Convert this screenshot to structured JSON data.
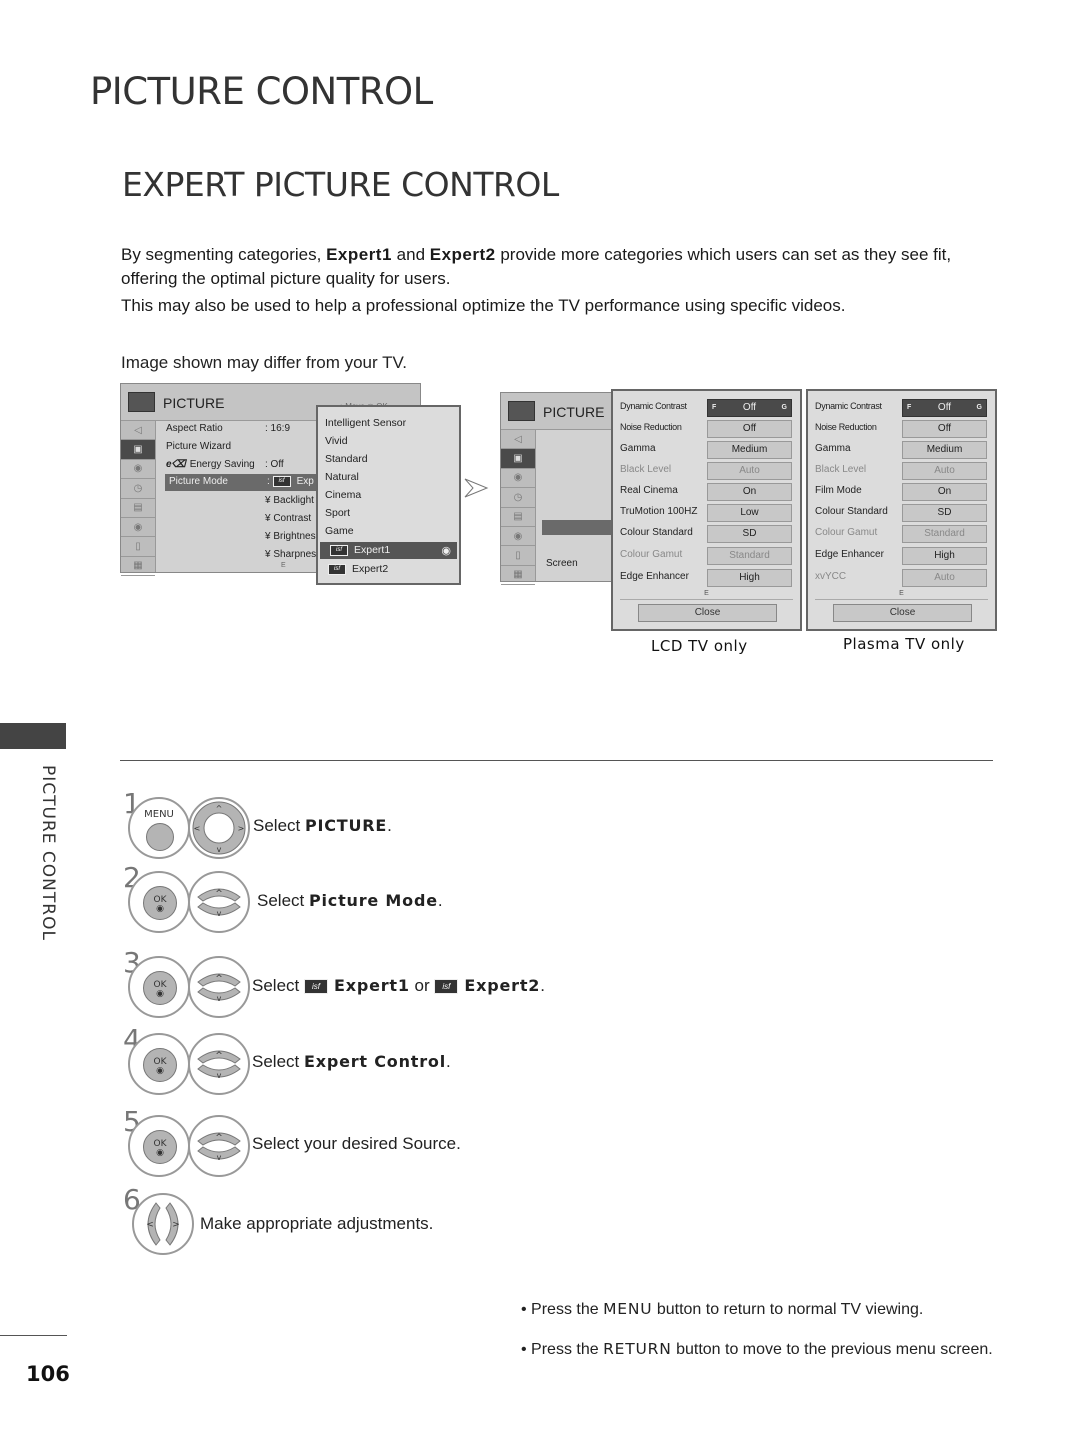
{
  "page": {
    "title": "PICTURE CONTROL",
    "subtitle": "EXPERT PICTURE CONTROL",
    "side_tab_label": "PICTURE CONTROL",
    "page_number": "106"
  },
  "intro": {
    "p1_before": "By segmenting categories, ",
    "expert1": "Expert1",
    "p1_and": " and ",
    "expert2": "Expert2",
    "p1_after": " provide more categories which users can set as they see fit, offering the optimal picture quality for users.",
    "p2": "This may also be used to help a professional optimize the TV performance using specific videos.",
    "note": "Image shown may differ from your TV."
  },
  "screen1": {
    "title": "PICTURE",
    "hint": "↕ Move   ◉ OK",
    "menu": [
      {
        "label": "Aspect Ratio",
        "value": ": 16:9"
      },
      {
        "label": "Picture Wizard",
        "value": ""
      },
      {
        "label": "Energy Saving",
        "value": ": Off",
        "icon": "eco-icon"
      },
      {
        "label": "Picture Mode",
        "value": ":",
        "selected_value": "Exp"
      }
    ],
    "sub_items": [
      "¥ Backlight",
      "¥ Contrast",
      "¥ Brightness",
      "¥ Sharpness"
    ],
    "scroll_hint": "E",
    "popup_items": [
      "Intelligent Sensor",
      "Vivid",
      "Standard",
      "Natural",
      "Cinema",
      "Sport",
      "Game",
      "Expert1",
      "Expert2"
    ],
    "popup_selected": "Expert1",
    "isf_badge": "isf"
  },
  "screen2": {
    "title": "PICTURE",
    "item": "Screen"
  },
  "panel_lcd": {
    "caption": "LCD TV only",
    "rows": [
      {
        "label": "Dynamic Contrast",
        "value": "Off",
        "state": "selected",
        "left": "F",
        "right": "G"
      },
      {
        "label": "Noise Reduction",
        "value": "Off",
        "state": "normal"
      },
      {
        "label": "Gamma",
        "value": "Medium",
        "state": "normal"
      },
      {
        "label": "Black Level",
        "value": "Auto",
        "state": "disabled"
      },
      {
        "label": "Real Cinema",
        "value": "On",
        "state": "normal"
      },
      {
        "label": "TruMotion 100HZ",
        "value": "Low",
        "state": "normal"
      },
      {
        "label": "Colour Standard",
        "value": "SD",
        "state": "normal"
      },
      {
        "label": "Colour Gamut",
        "value": "Standard",
        "state": "disabled"
      },
      {
        "label": "Edge Enhancer",
        "value": "High",
        "state": "normal"
      }
    ],
    "scroll_hint": "E",
    "close_label": "Close"
  },
  "panel_plasma": {
    "caption": "Plasma TV only",
    "rows": [
      {
        "label": "Dynamic Contrast",
        "value": "Off",
        "state": "selected",
        "left": "F",
        "right": "G"
      },
      {
        "label": "Noise Reduction",
        "value": "Off",
        "state": "normal"
      },
      {
        "label": "Gamma",
        "value": "Medium",
        "state": "normal"
      },
      {
        "label": "Black Level",
        "value": "Auto",
        "state": "disabled"
      },
      {
        "label": "Film Mode",
        "value": "On",
        "state": "normal"
      },
      {
        "label": "Colour Standard",
        "value": "SD",
        "state": "normal"
      },
      {
        "label": "Colour Gamut",
        "value": "Standard",
        "state": "disabled"
      },
      {
        "label": "Edge Enhancer",
        "value": "High",
        "state": "normal"
      },
      {
        "label": "xvYCC",
        "value": "Auto",
        "state": "disabled"
      }
    ],
    "scroll_hint": "E",
    "close_label": "Close"
  },
  "steps": [
    {
      "num": "1",
      "button": "MENU",
      "pre": "Select ",
      "bold": "PICTURE",
      "post": "."
    },
    {
      "num": "2",
      "button": "OK",
      "pre": "Select ",
      "bold": "Picture Mode",
      "post": "."
    },
    {
      "num": "3",
      "button": "OK",
      "pre": "Select ",
      "bold": "Expert1",
      "mid": " or ",
      "bold2": "Expert2",
      "post": "."
    },
    {
      "num": "4",
      "button": "OK",
      "pre": "Select ",
      "bold": "Expert Control",
      "post": "."
    },
    {
      "num": "5",
      "button": "OK",
      "pre": "Select your desired Source.",
      "bold": "",
      "post": ""
    },
    {
      "num": "6",
      "button": "",
      "pre": "Make appropriate adjustments.",
      "bold": "",
      "post": ""
    }
  ],
  "bullets": [
    {
      "pre": "• Press the ",
      "bold": "MENU",
      "post": " button to return to normal TV viewing."
    },
    {
      "pre": "• Press the ",
      "bold": "RETURN",
      "post": " button to move to the previous menu screen."
    }
  ]
}
